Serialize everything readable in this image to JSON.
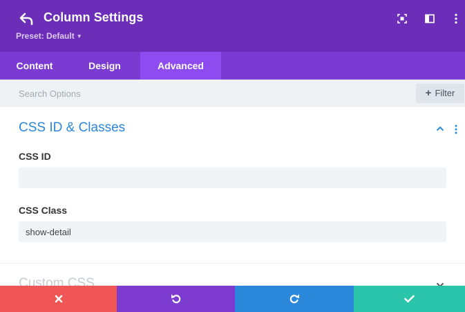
{
  "header": {
    "title": "Column Settings",
    "preset_label": "Preset: Default",
    "background": "#6c2eb9"
  },
  "tabs": [
    {
      "label": "Content",
      "active": false
    },
    {
      "label": "Design",
      "active": false
    },
    {
      "label": "Advanced",
      "active": true
    }
  ],
  "search": {
    "placeholder": "Search Options",
    "filter_label": "Filter"
  },
  "section": {
    "title": "CSS ID & Classes",
    "css_id": {
      "label": "CSS ID",
      "value": ""
    },
    "css_class": {
      "label": "CSS Class",
      "value": "show-detail"
    }
  },
  "section2": {
    "title": "Custom CSS"
  },
  "footer": {
    "buttons": [
      {
        "name": "discard",
        "icon": "close-icon",
        "color": "#ef5555"
      },
      {
        "name": "undo",
        "icon": "undo-icon",
        "color": "#7e3bd0"
      },
      {
        "name": "redo",
        "icon": "redo-icon",
        "color": "#2b87da"
      },
      {
        "name": "save",
        "icon": "check-icon",
        "color": "#29c4a9"
      }
    ]
  },
  "colors": {
    "accent_blue": "#2b87da",
    "tab_bar": "#7b3bd2",
    "tab_active": "#8e4cf0"
  }
}
